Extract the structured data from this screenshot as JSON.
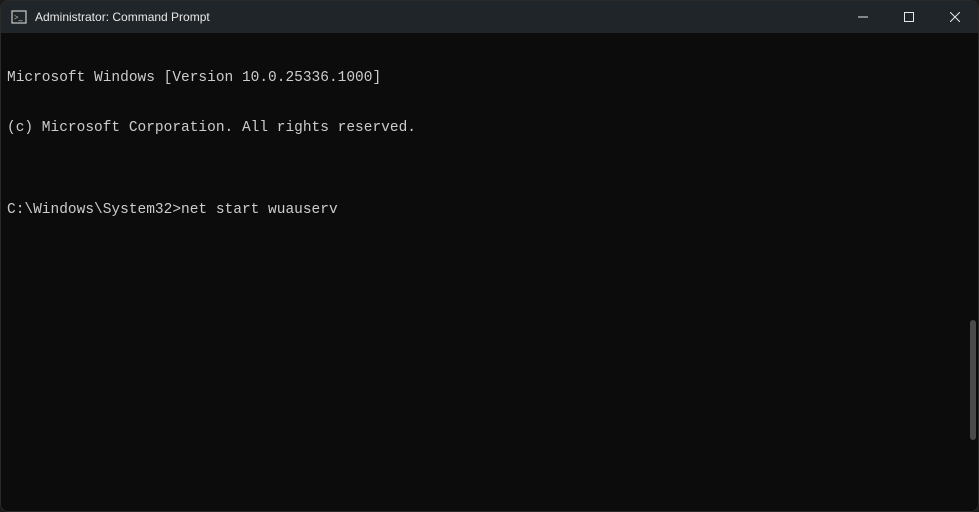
{
  "window": {
    "title": "Administrator: Command Prompt"
  },
  "terminal": {
    "line1": "Microsoft Windows [Version 10.0.25336.1000]",
    "line2": "(c) Microsoft Corporation. All rights reserved.",
    "blank": "",
    "prompt": "C:\\Windows\\System32>",
    "command": "net start wuauserv"
  }
}
